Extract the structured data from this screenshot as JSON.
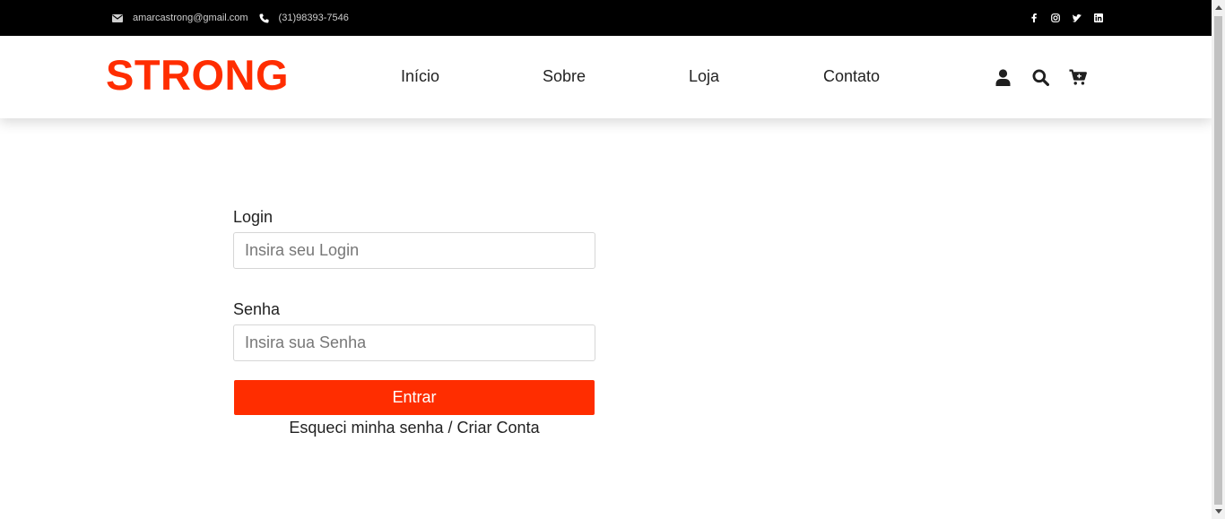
{
  "topbar": {
    "email": "amarcastrong@gmail.com",
    "phone": "(31)98393-7546",
    "social_icons": [
      "facebook-icon",
      "instagram-icon",
      "twitter-icon",
      "linkedin-icon"
    ]
  },
  "header": {
    "logo": "STRONG",
    "nav": [
      "Início",
      "Sobre",
      "Loja",
      "Contato"
    ],
    "icons": [
      "user-icon",
      "search-icon",
      "cart-icon"
    ]
  },
  "form": {
    "login_label": "Login",
    "login_placeholder": "Insira seu Login",
    "password_label": "Senha",
    "password_placeholder": "Insira sua Senha",
    "submit_label": "Entrar",
    "forgot_link": "Esqueci minha senha",
    "separator": "/",
    "create_link": "Criar Conta"
  },
  "colors": {
    "brand": "#ff2d00",
    "topbar_bg": "#000000",
    "text": "#222222"
  }
}
